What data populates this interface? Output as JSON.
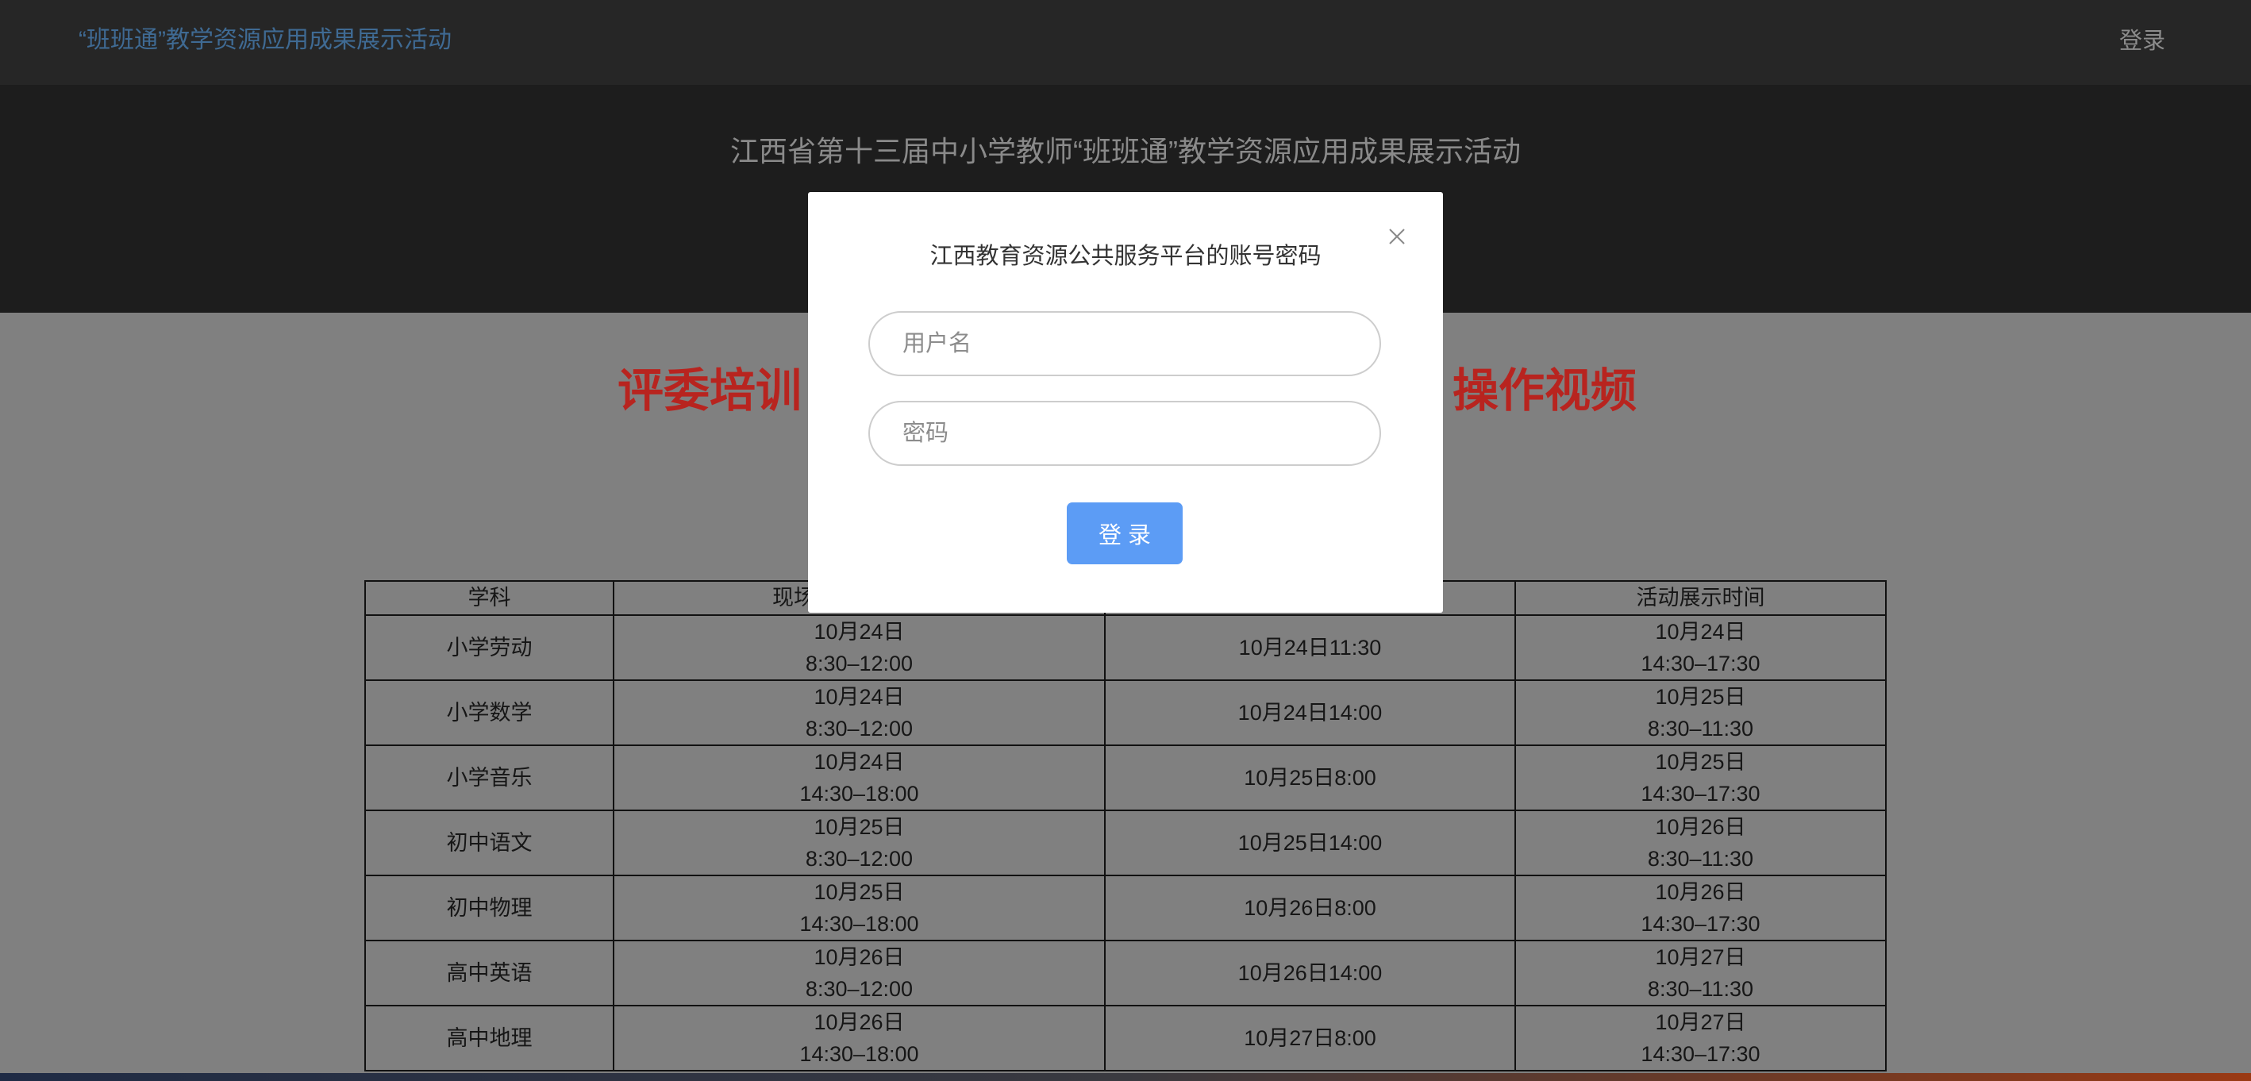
{
  "navbar": {
    "title": "“班班通”教学资源应用成果展示活动",
    "login_label": "登录"
  },
  "banner": {
    "title": "江西省第十三届中小学教师“班班通”教学资源应用成果展示活动"
  },
  "main": {
    "heading_left": "评委培训",
    "heading_right": "操作视频"
  },
  "table": {
    "headers": [
      "学科",
      "现场",
      "",
      "活动展示时间"
    ],
    "rows": [
      {
        "subject": "小学劳动",
        "onsite_date": "10月24日",
        "onsite_time": "8:30–12:00",
        "col3_time": "10月24日11:30",
        "showcase_date": "10月24日",
        "showcase_time": "14:30–17:30"
      },
      {
        "subject": "小学数学",
        "onsite_date": "10月24日",
        "onsite_time": "8:30–12:00",
        "col3_time": "10月24日14:00",
        "showcase_date": "10月25日",
        "showcase_time": "8:30–11:30"
      },
      {
        "subject": "小学音乐",
        "onsite_date": "10月24日",
        "onsite_time": "14:30–18:00",
        "col3_time": "10月25日8:00",
        "showcase_date": "10月25日",
        "showcase_time": "14:30–17:30"
      },
      {
        "subject": "初中语文",
        "onsite_date": "10月25日",
        "onsite_time": "8:30–12:00",
        "col3_time": "10月25日14:00",
        "showcase_date": "10月26日",
        "showcase_time": "8:30–11:30"
      },
      {
        "subject": "初中物理",
        "onsite_date": "10月25日",
        "onsite_time": "14:30–18:00",
        "col3_time": "10月26日8:00",
        "showcase_date": "10月26日",
        "showcase_time": "14:30–17:30"
      },
      {
        "subject": "高中英语",
        "onsite_date": "10月26日",
        "onsite_time": "8:30–12:00",
        "col3_time": "10月26日14:00",
        "showcase_date": "10月27日",
        "showcase_time": "8:30–11:30"
      },
      {
        "subject": "高中地理",
        "onsite_date": "10月26日",
        "onsite_time": "14:30–18:00",
        "col3_time": "10月27日8:00",
        "showcase_date": "10月27日",
        "showcase_time": "14:30–17:30"
      }
    ]
  },
  "modal": {
    "title": "江西教育资源公共服务平台的账号密码",
    "close_icon": "close-icon",
    "username_placeholder": "用户名",
    "password_placeholder": "密码",
    "login_button_label": "登 录"
  },
  "colors": {
    "navbar_bg": "#262626",
    "banner_bg": "#1d1d1d",
    "heading_red": "#b8241f",
    "button_blue": "#5c9cf5"
  }
}
